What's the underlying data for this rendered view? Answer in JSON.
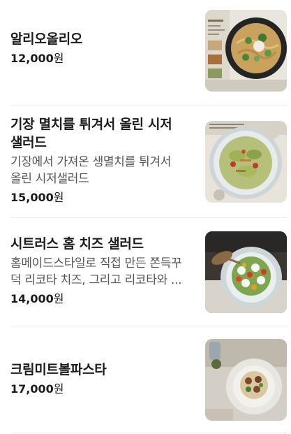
{
  "menu": {
    "items": [
      {
        "name_lines": [
          "알리오올리오"
        ],
        "description_lines": [],
        "price": "12,000",
        "currency": "원",
        "photo": "aglio-olio-pasta-photo"
      },
      {
        "name_lines": [
          "기장 멸치를 튀겨서 올린 시저",
          "샐러드"
        ],
        "description_lines": [
          "기장에서 가져온 생멸치를 튀겨서",
          "올린 시저샐러드"
        ],
        "price": "15,000",
        "currency": "원",
        "photo": "anchovy-caesar-salad-photo"
      },
      {
        "name_lines": [
          "시트러스 홈 치즈 샐러드"
        ],
        "description_lines": [
          "홈메이드스타일로 직접 만든 쫀득꾸",
          "덕 리코타 치즈, 그리고 리코타와 ..."
        ],
        "price": "14,000",
        "currency": "원",
        "photo": "citrus-cheese-salad-photo"
      },
      {
        "name_lines": [
          "크림미트볼파스타"
        ],
        "description_lines": [],
        "price": "17,000",
        "currency": "원",
        "photo": "cream-meatball-pasta-photo"
      }
    ]
  }
}
